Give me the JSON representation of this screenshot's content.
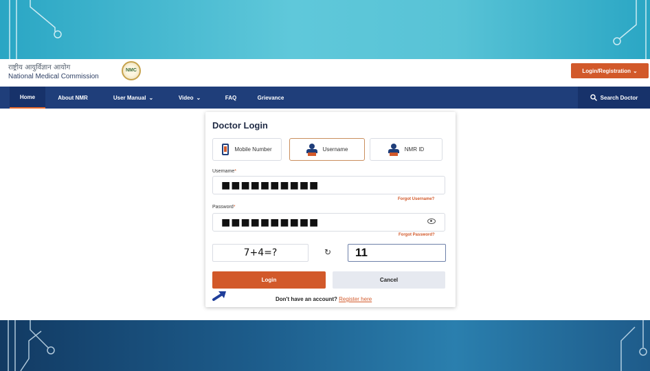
{
  "header": {
    "org_hindi": "राष्ट्रीय आयुर्विज्ञान आयोग",
    "org_name": "National Medical Commission",
    "emblem_text": "NMC",
    "login_registration": "Login/Registration"
  },
  "nav": {
    "items": [
      {
        "label": "Home",
        "active": true
      },
      {
        "label": "About NMR"
      },
      {
        "label": "User Manual",
        "dropdown": true
      },
      {
        "label": "Video",
        "dropdown": true
      },
      {
        "label": "FAQ"
      },
      {
        "label": "Grievance"
      }
    ],
    "search_doctor": "Search Doctor"
  },
  "login": {
    "title": "Doctor Login",
    "tabs": [
      {
        "label": "Mobile Number",
        "icon": "phone-icon"
      },
      {
        "label": "Username",
        "icon": "user-icon",
        "active": true
      },
      {
        "label": "NMR ID",
        "icon": "user-icon"
      }
    ],
    "username_label": "Username",
    "username_value": "■■■■■■■■■■",
    "forgot_username": "Forgot Username?",
    "password_label": "Password",
    "password_value": "■■■■■■■■■■",
    "forgot_password": "Forgot Password?",
    "captcha": "7+4=?",
    "captcha_answer": "11",
    "login_button": "Login",
    "cancel_button": "Cancel",
    "no_account": "Don't have an account?",
    "register_here": "Register here"
  },
  "colors": {
    "primary": "#1f3e7a",
    "accent": "#d2592a",
    "top_banner": "#4fbfd4",
    "bottom_banner": "#1d5d8c"
  }
}
